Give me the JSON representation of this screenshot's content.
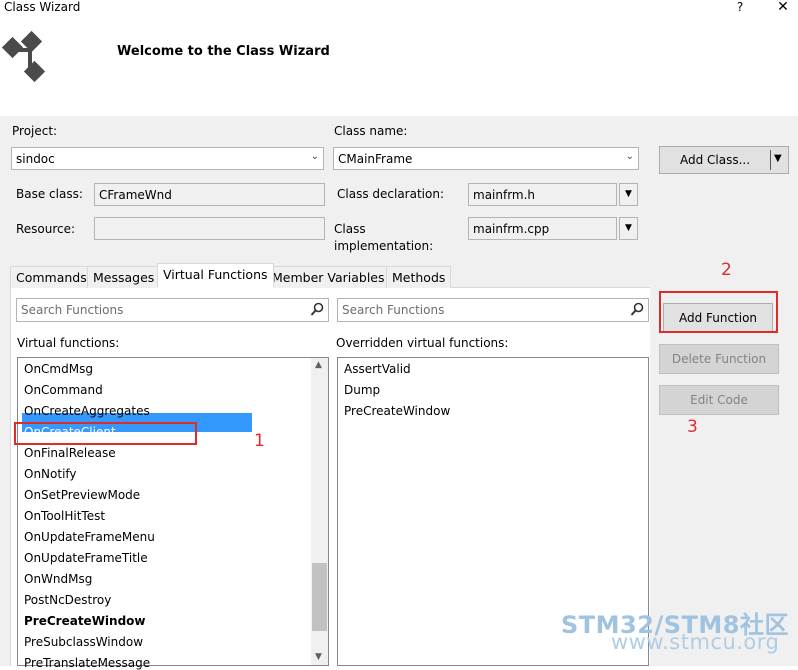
{
  "window": {
    "title": "Class Wizard",
    "help_label": "?",
    "close_label": "✕",
    "welcome": "Welcome to the Class Wizard"
  },
  "form": {
    "project_label": "Project:",
    "project_value": "sindoc",
    "class_name_label": "Class name:",
    "class_name_value": "CMainFrame",
    "add_class_label": "Add Class...",
    "base_class_label": "Base class:",
    "base_class_value": "CFrameWnd",
    "resource_label": "Resource:",
    "resource_value": "",
    "class_declaration_label": "Class declaration:",
    "class_declaration_value": "mainfrm.h",
    "class_implementation_label_line1": "Class",
    "class_implementation_label_line2": "implementation:",
    "class_implementation_value": "mainfrm.cpp"
  },
  "tabs": [
    {
      "label": "Commands"
    },
    {
      "label": "Messages"
    },
    {
      "label": "Virtual Functions",
      "active": true
    },
    {
      "label": "Member Variables"
    },
    {
      "label": "Methods"
    }
  ],
  "virtual_functions": {
    "search_placeholder": "Search Functions",
    "list_label": "Virtual functions:",
    "items": [
      {
        "label": "OnCmdMsg"
      },
      {
        "label": "OnCommand"
      },
      {
        "label": "OnCreateAggregates"
      },
      {
        "label": "OnCreateClient",
        "selected": true
      },
      {
        "label": "OnFinalRelease"
      },
      {
        "label": "OnNotify"
      },
      {
        "label": "OnSetPreviewMode"
      },
      {
        "label": "OnToolHitTest"
      },
      {
        "label": "OnUpdateFrameMenu"
      },
      {
        "label": "OnUpdateFrameTitle"
      },
      {
        "label": "OnWndMsg"
      },
      {
        "label": "PostNcDestroy"
      },
      {
        "label": "PreCreateWindow",
        "bold": true
      },
      {
        "label": "PreSubclassWindow"
      },
      {
        "label": "PreTranslateMessage"
      }
    ],
    "scroll_position": 0.72
  },
  "overridden": {
    "search_placeholder": "Search Functions",
    "list_label": "Overridden virtual functions:",
    "items": [
      {
        "label": "AssertValid"
      },
      {
        "label": "Dump"
      },
      {
        "label": "PreCreateWindow"
      }
    ]
  },
  "buttons": {
    "add_function": "Add Function",
    "delete_function": "Delete Function",
    "edit_code": "Edit Code"
  },
  "annotations": {
    "one": "1",
    "two": "2",
    "three": "3"
  },
  "watermark": {
    "line1": "STM32/STM8社区",
    "line2": "www.stmcu.org"
  },
  "colors": {
    "selection": "#3399ff",
    "annotation_red": "#e02b2b"
  }
}
